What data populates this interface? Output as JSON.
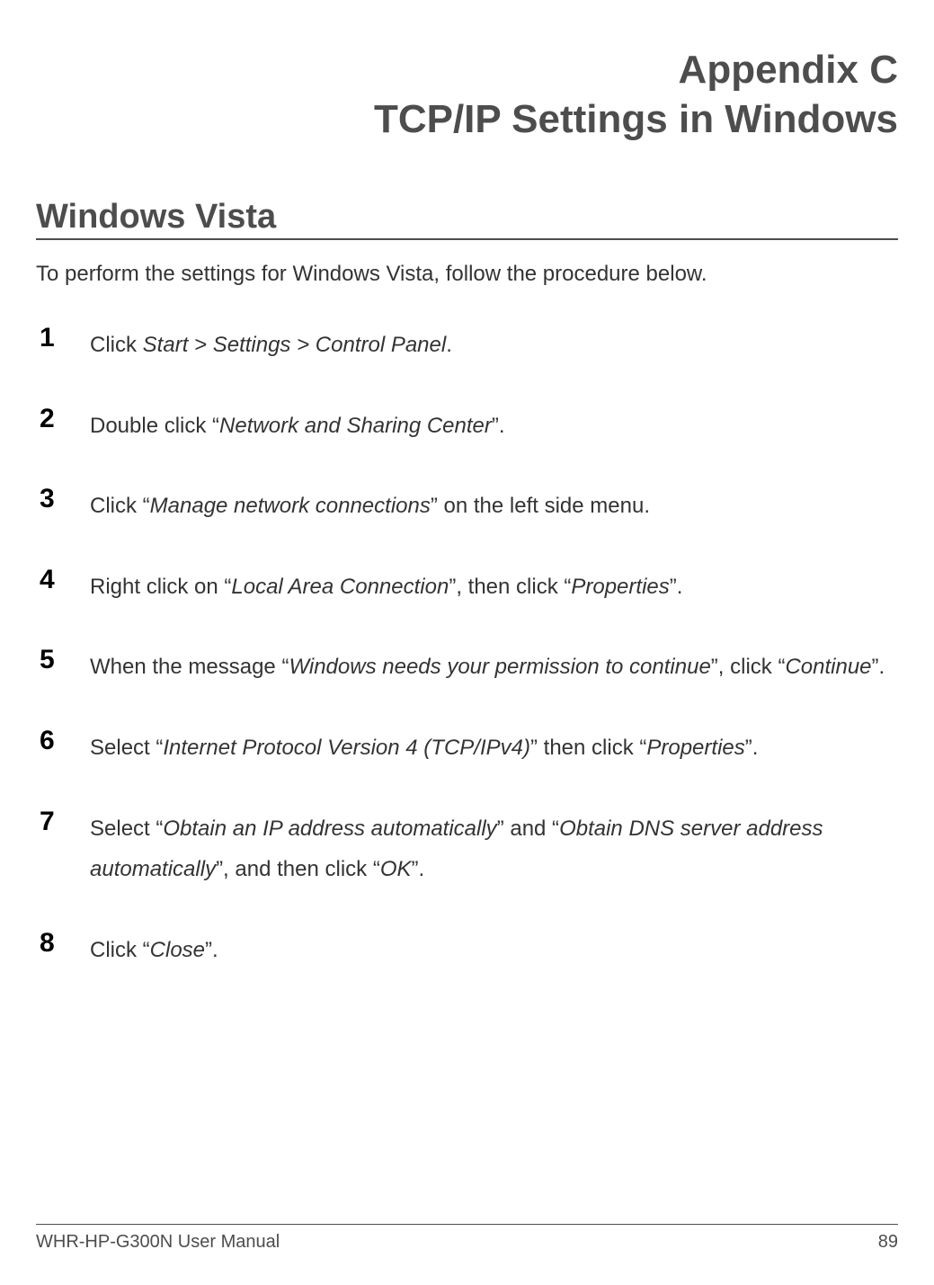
{
  "appendix": {
    "line1": "Appendix C",
    "line2": "TCP/IP Settings in Windows"
  },
  "section": {
    "heading": "Windows Vista",
    "intro": "To perform the settings for Windows Vista, follow the procedure below."
  },
  "steps": [
    {
      "num": "1",
      "html": "Click <em>Start &gt; Settings &gt; Control Panel</em>."
    },
    {
      "num": "2",
      "html": "Double click “<em>Network and Sharing Center</em>”."
    },
    {
      "num": "3",
      "html": "Click “<em>Manage network connections</em>” on the left side menu."
    },
    {
      "num": "4",
      "html": "Right click on “<em>Local Area Connection</em>”, then click “<em>Properties</em>”."
    },
    {
      "num": "5",
      "html": "When the message “<em>Windows needs your permission to continue</em>”, click “<em>Continue</em>”."
    },
    {
      "num": "6",
      "html": "Select “<em>Internet Protocol Version 4 (TCP/IPv4)</em>” then click “<em>Properties</em>”."
    },
    {
      "num": "7",
      "html": "Select “<em>Obtain an IP address automatically</em>” and “<em>Obtain DNS server address automatically</em>”, and then click “<em>OK</em>”."
    },
    {
      "num": "8",
      "html": "Click “<em>Close</em>”."
    }
  ],
  "footer": {
    "manual": "WHR-HP-G300N User Manual",
    "page": "89"
  }
}
